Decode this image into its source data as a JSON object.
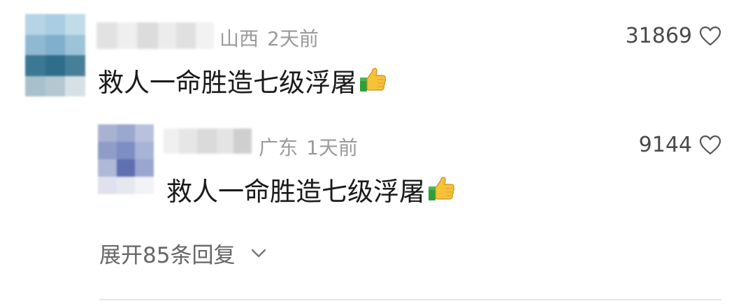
{
  "comment": {
    "location": "山西",
    "time": "2天前",
    "likes": "31869",
    "text": "救人一命胜造七级浮屠",
    "emoji_icon": "thumbs-up-icon"
  },
  "reply": {
    "location": "广东",
    "time": "1天前",
    "likes": "9144",
    "text": "救人一命胜造七级浮屠",
    "emoji_icon": "thumbs-up-icon"
  },
  "expand": {
    "label": "展开85条回复",
    "icon": "chevron-down-icon"
  },
  "colors": {
    "meta": "#9a9a9a",
    "text": "#1a1a1a",
    "likes": "#4a4a4a",
    "expand": "#666666",
    "divider": "#e6e6e6"
  }
}
